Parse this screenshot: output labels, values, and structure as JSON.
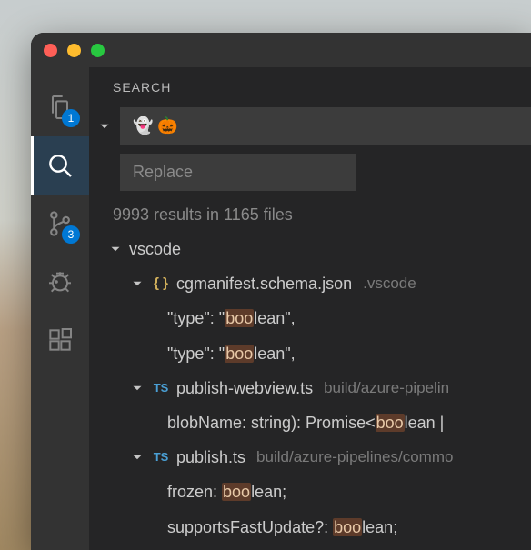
{
  "window": {
    "titlebar": {}
  },
  "activity_bar": {
    "explorer_badge": "1",
    "scm_badge": "3"
  },
  "sidebar": {
    "header": "SEARCH",
    "search_value": "👻 🎃",
    "replace_placeholder": "Replace",
    "results_summary": "9993 results in 1165 files"
  },
  "tree": {
    "folder": "vscode",
    "files": [
      {
        "icon_text": "{ }",
        "icon_class": "json",
        "name": "cgmanifest.schema.json",
        "path": ".vscode",
        "matches": [
          {
            "pre": "\"type\": \"",
            "hit": "boo",
            "post": "lean\","
          },
          {
            "pre": "\"type\": \"",
            "hit": "boo",
            "post": "lean\","
          }
        ]
      },
      {
        "icon_text": "TS",
        "icon_class": "ts",
        "name": "publish-webview.ts",
        "path": "build/azure-pipelin",
        "matches": [
          {
            "pre": "blobName: string): Promise<",
            "hit": "boo",
            "post": "lean | "
          }
        ]
      },
      {
        "icon_text": "TS",
        "icon_class": "ts",
        "name": "publish.ts",
        "path": "build/azure-pipelines/commo",
        "matches": [
          {
            "pre": "frozen: ",
            "hit": "boo",
            "post": "lean;"
          },
          {
            "pre": "supportsFastUpdate?: ",
            "hit": "boo",
            "post": "lean;"
          }
        ]
      }
    ]
  }
}
